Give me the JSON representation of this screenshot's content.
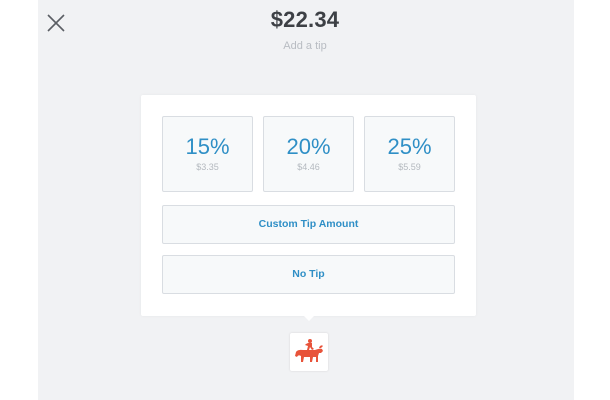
{
  "header": {
    "amount": "$22.34",
    "subtitle": "Add a tip"
  },
  "tips": [
    {
      "percent": "15%",
      "amount": "$3.35"
    },
    {
      "percent": "20%",
      "amount": "$4.46"
    },
    {
      "percent": "25%",
      "amount": "$5.59"
    }
  ],
  "buttons": {
    "custom": "Custom Tip Amount",
    "none": "No Tip"
  },
  "colors": {
    "accent": "#2f8fc6",
    "logo": "#e8533a"
  },
  "icons": {
    "close": "close-icon",
    "merchant_logo": "bull-rider-logo"
  }
}
